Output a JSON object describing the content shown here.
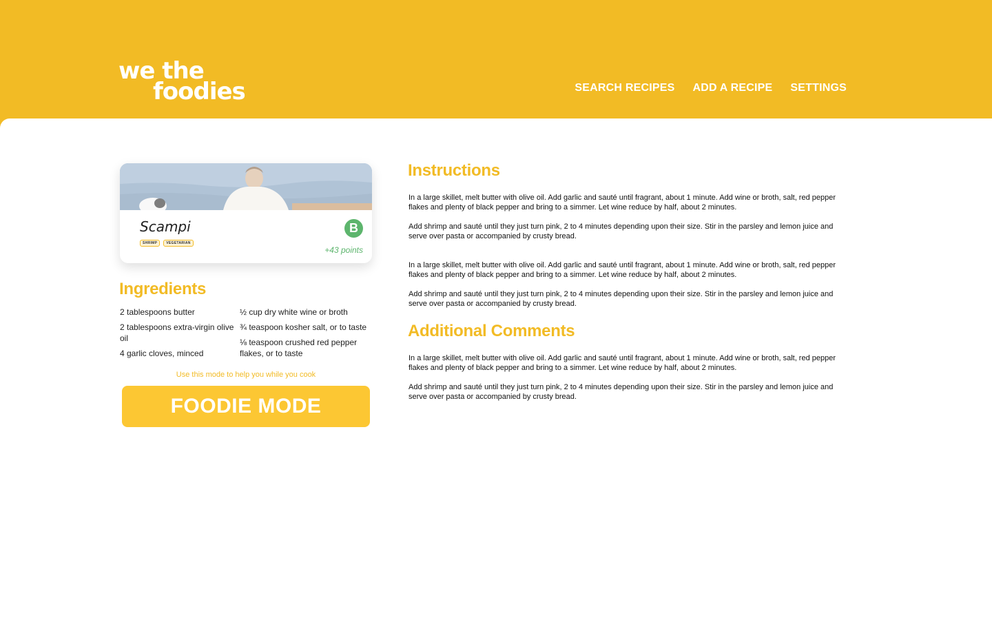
{
  "brand": {
    "line1": "we the",
    "line2": "foodies"
  },
  "nav": {
    "search": "SEARCH RECIPES",
    "add": "ADD A RECIPE",
    "settings": "SETTINGS"
  },
  "recipe_card": {
    "title": "Scampi",
    "tags": [
      "SHRIMP",
      "VEGETARIAN"
    ],
    "grade": "B",
    "points": "+43 points",
    "image": "photo of a person at the sea with a dog"
  },
  "ingredients": {
    "title": "Ingredients",
    "col1": [
      "2 tablespoons butter",
      "2 tablespoons extra-virgin olive oil",
      "4 garlic cloves, minced"
    ],
    "col2": [
      "½ cup dry white wine or broth",
      "¾ teaspoon kosher salt, or to taste",
      "⅛ teaspoon crushed red pepper flakes, or to taste"
    ]
  },
  "foodie_mode": {
    "hint": "Use this mode to help you while you cook",
    "button": "FOODIE MODE"
  },
  "instructions": {
    "title": "Instructions",
    "paragraphs": [
      "In a large skillet, melt butter with olive oil. Add garlic and sauté until fragrant, about 1 minute. Add wine or broth, salt, red pepper flakes and plenty of black pepper and bring to a simmer. Let wine reduce by half, about 2 minutes.",
      "Add shrimp and sauté until they just turn pink, 2 to 4 minutes depending upon their size. Stir in the parsley and lemon juice and serve over pasta or accompanied by crusty bread.",
      "In a large skillet, melt butter with olive oil. Add garlic and sauté until fragrant, about 1 minute. Add wine or broth, salt, red pepper flakes and plenty of black pepper and bring to a simmer. Let wine reduce by half, about 2 minutes.",
      "Add shrimp and sauté until they just turn pink, 2 to 4 minutes depending upon their size. Stir in the parsley and lemon juice and serve over pasta or accompanied by crusty bread."
    ]
  },
  "comments": {
    "title": "Additional Comments",
    "paragraphs": [
      "In a large skillet, melt butter with olive oil. Add garlic and sauté until fragrant, about 1 minute. Add wine or broth, salt, red pepper flakes and plenty of black pepper and bring to a simmer. Let wine reduce by half, about 2 minutes.",
      "Add shrimp and sauté until they just turn pink, 2 to 4 minutes depending upon their size. Stir in the parsley and lemon juice and serve over pasta or accompanied by crusty bread."
    ]
  },
  "colors": {
    "brand_yellow": "#f2bb25",
    "button_yellow": "#fcc733",
    "grade_green": "#5db56d"
  }
}
